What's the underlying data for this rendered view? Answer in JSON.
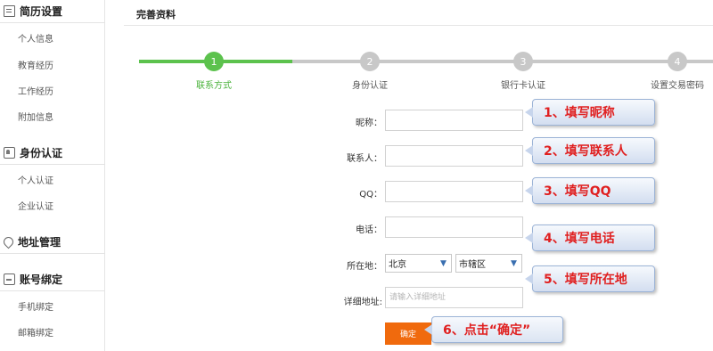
{
  "sidebar": {
    "sections": [
      {
        "title": "简历设置",
        "icon": "resume-icon",
        "items": [
          "个人信息",
          "教育经历",
          "工作经历",
          "附加信息"
        ]
      },
      {
        "title": "身份认证",
        "icon": "id-card-icon",
        "items": [
          "个人认证",
          "企业认证"
        ]
      },
      {
        "title": "地址管理",
        "icon": "location-pin-icon",
        "items": []
      },
      {
        "title": "账号绑定",
        "icon": "account-icon",
        "items": [
          "手机绑定",
          "邮箱绑定"
        ]
      }
    ]
  },
  "main": {
    "title": "完善资料",
    "steps": [
      {
        "num": "1",
        "label": "联系方式",
        "active": true
      },
      {
        "num": "2",
        "label": "身份认证",
        "active": false
      },
      {
        "num": "3",
        "label": "银行卡认证",
        "active": false
      },
      {
        "num": "4",
        "label": "设置交易密码",
        "active": false
      }
    ],
    "form": {
      "nickname_label": "昵称：",
      "contact_label": "联系人：",
      "qq_label": "QQ：",
      "phone_label": "电话：",
      "location_label": "所在地：",
      "city": "北京",
      "district": "市辖区",
      "address_label": "详细地址:",
      "address_placeholder": "请输入详细地址",
      "confirm": "确定"
    },
    "callouts": [
      "1、填写昵称",
      "2、填写联系人",
      "3、填写QQ",
      "4、填写电话",
      "5、填写所在地",
      "6、点击“确定”"
    ]
  },
  "colors": {
    "accent_green": "#5cc24d",
    "button_orange": "#f06a0d",
    "callout_text": "#e02020"
  }
}
